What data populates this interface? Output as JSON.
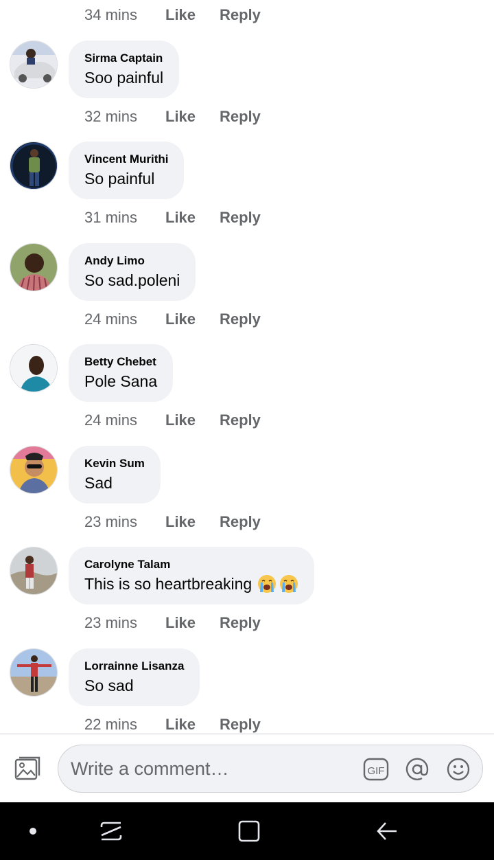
{
  "actions": {
    "like": "Like",
    "reply": "Reply"
  },
  "first_time": "34 mins",
  "comments": [
    {
      "author": "Sirma Captain",
      "text": "Soo painful",
      "time": "32 mins"
    },
    {
      "author": "Vincent Murithi",
      "text": "So painful",
      "time": "31 mins"
    },
    {
      "author": "Andy Limo",
      "text": "So sad.poleni",
      "time": "24 mins"
    },
    {
      "author": "Betty Chebet",
      "text": "Pole Sana",
      "time": "24 mins"
    },
    {
      "author": "Kevin Sum",
      "text": "Sad",
      "time": "23 mins"
    },
    {
      "author": "Carolyne Talam",
      "text": "This is so heartbreaking",
      "emoji": [
        "loudly-crying-face",
        "loudly-crying-face"
      ],
      "time": "23 mins"
    },
    {
      "author": "Lorrainne Lisanza",
      "text": "So sad",
      "time": "22 mins"
    }
  ],
  "composer": {
    "placeholder": "Write a comment…",
    "icons": [
      "photo-icon",
      "gif-icon",
      "mention-icon",
      "emoji-icon"
    ],
    "gif_label": "GIF"
  },
  "navbar": {
    "icons": [
      "home-dot-icon",
      "recent-apps-icon",
      "overview-icon",
      "back-icon"
    ]
  },
  "colors": {
    "bubble": "#f0f2f5",
    "meta_text": "#65676b",
    "nav_bar": "#000000"
  }
}
